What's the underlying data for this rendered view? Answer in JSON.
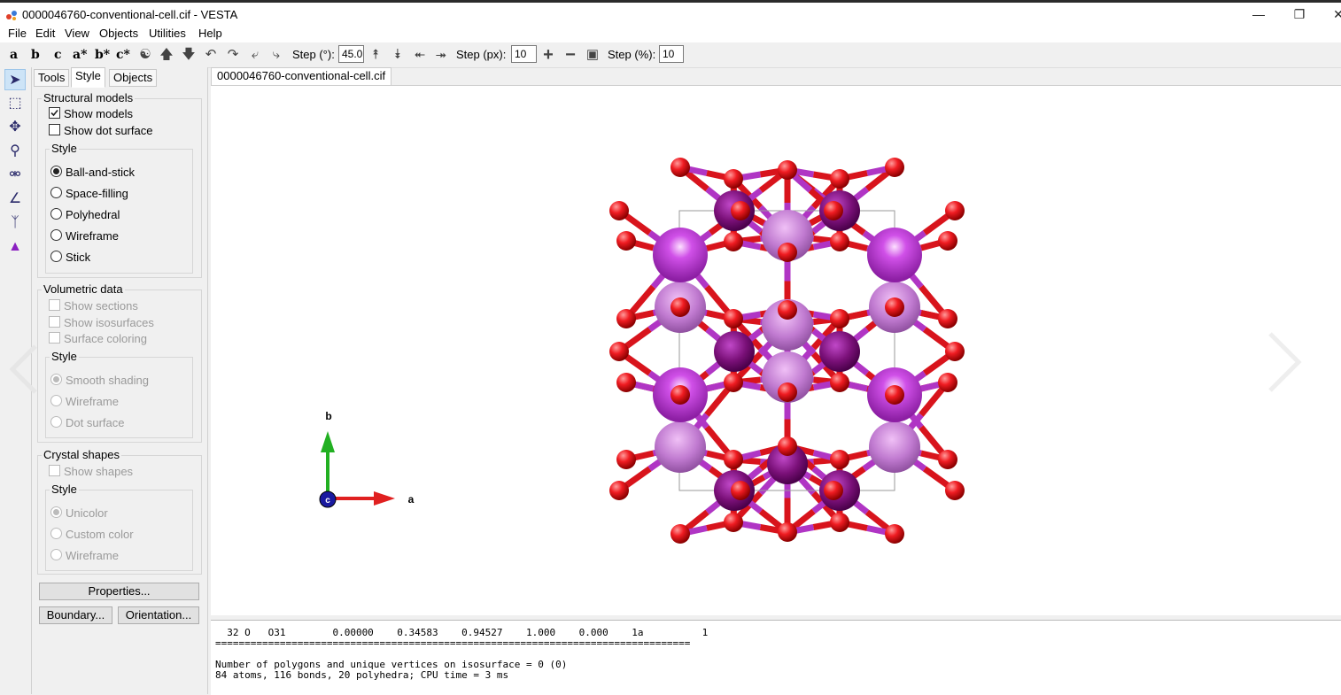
{
  "window": {
    "title": "0000046760-conventional-cell.cif - VESTA"
  },
  "menu": [
    "File",
    "Edit",
    "View",
    "Objects",
    "Utilities",
    "Help"
  ],
  "toolbar": {
    "axis_buttons": [
      "a",
      "b",
      "c",
      "a*",
      "b*",
      "c*"
    ],
    "step_deg_label": "Step (°):",
    "step_deg_value": "45.0",
    "step_px_label": "Step (px):",
    "step_px_value": "10",
    "step_pct_label": "Step (%):",
    "step_pct_value": "10"
  },
  "panel": {
    "tabs": [
      "Tools",
      "Style",
      "Objects"
    ],
    "active_tab": "Style",
    "structural": {
      "title": "Structural models",
      "show_models": "Show models",
      "show_dot_surface": "Show dot surface",
      "style_title": "Style",
      "styles": [
        "Ball-and-stick",
        "Space-filling",
        "Polyhedral",
        "Wireframe",
        "Stick"
      ],
      "selected_style": "Ball-and-stick"
    },
    "volumetric": {
      "title": "Volumetric data",
      "show_sections": "Show sections",
      "show_isosurfaces": "Show isosurfaces",
      "surface_coloring": "Surface coloring",
      "style_title": "Style",
      "styles": [
        "Smooth shading",
        "Wireframe",
        "Dot surface"
      ]
    },
    "crystal": {
      "title": "Crystal shapes",
      "show_shapes": "Show shapes",
      "style_title": "Style",
      "styles": [
        "Unicolor",
        "Custom color",
        "Wireframe"
      ]
    },
    "buttons": {
      "properties": "Properties...",
      "boundary": "Boundary...",
      "orientation": "Orientation..."
    }
  },
  "document_tab": "0000046760-conventional-cell.cif",
  "axes": {
    "a": "a",
    "b": "b",
    "c": "c"
  },
  "colors": {
    "oxygen": "#e8141c",
    "metal": "#c040d8",
    "metal_dark": "#8a1a8a",
    "axis_a": "#e02020",
    "axis_b": "#22b022",
    "axis_c": "#1a1aa0"
  },
  "console": {
    "line1": "  32 O   O31        0.00000    0.34583    0.94527    1.000    0.000    1a          1",
    "line2": "=================================================================================",
    "line3": "",
    "line4": "Number of polygons and unique vertices on isosurface = 0 (0)",
    "line5": "84 atoms, 116 bonds, 20 polyhedra; CPU time = 3 ms"
  }
}
